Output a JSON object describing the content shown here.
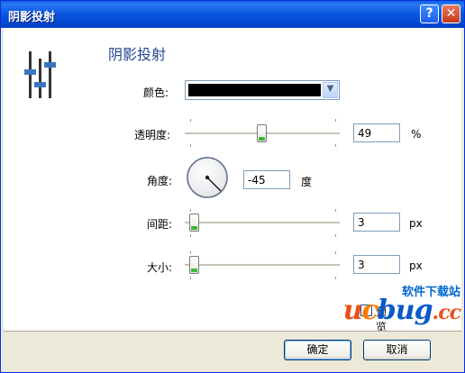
{
  "window": {
    "title": "阴影投射",
    "help_label": "?",
    "close_label": "✕"
  },
  "heading": "阴影投射",
  "colors": {
    "accent": "#21468E",
    "titlebar": "#0A58E0",
    "shadow_color": "#000000"
  },
  "fields": {
    "color_label": "颜色:",
    "opacity_label": "透明度:",
    "opacity_value": "49",
    "opacity_unit": "%",
    "opacity_level": 0.49,
    "angle_label": "角度:",
    "angle_value": "-45",
    "angle_unit": "度",
    "distance_label": "间距:",
    "distance_value": "3",
    "distance_unit": "px",
    "size_label": "大小:",
    "size_value": "3",
    "size_unit": "px"
  },
  "preview": {
    "label": "预览",
    "checked": true
  },
  "buttons": {
    "ok": "确定",
    "cancel": "取消"
  },
  "watermark": {
    "cn": "软件下载站",
    "u": "u",
    "c": "c",
    "bug": "bug",
    "cc": ".cc"
  },
  "icons": {
    "header_icon": "sliders-icon",
    "dropdown": "chevron-down-icon",
    "angle_dial": "angle-dial-icon"
  }
}
